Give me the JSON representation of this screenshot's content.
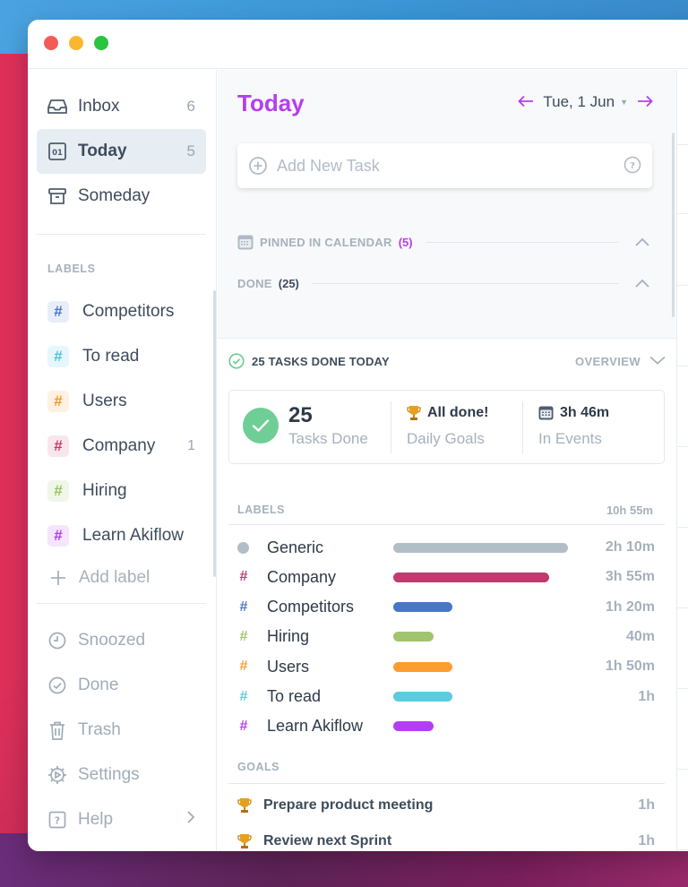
{
  "window": {
    "controls": [
      "close",
      "minimize",
      "maximize"
    ]
  },
  "sidebar": {
    "nav": [
      {
        "label": "Inbox",
        "count": "6",
        "icon": "inbox-icon"
      },
      {
        "label": "Today",
        "count": "5",
        "icon": "calendar-day-icon",
        "active": true
      },
      {
        "label": "Someday",
        "count": "",
        "icon": "archive-icon"
      }
    ],
    "labels_heading": "LABELS",
    "labels": [
      {
        "label": "Competitors",
        "count": "",
        "color": "#4a76c9",
        "bg": "#e8eef8"
      },
      {
        "label": "To read",
        "count": "",
        "color": "#4fc3dd",
        "bg": "#e6f7fb"
      },
      {
        "label": "Users",
        "count": "",
        "color": "#f59a2c",
        "bg": "#fef1e2"
      },
      {
        "label": "Company",
        "count": "1",
        "color": "#c93a6c",
        "bg": "#f9e6ed"
      },
      {
        "label": "Hiring",
        "count": "",
        "color": "#9ac266",
        "bg": "#f0f6e8"
      },
      {
        "label": "Learn Akiflow",
        "count": "",
        "color": "#b03ef3",
        "bg": "#f4e6fd"
      }
    ],
    "add_label": "Add label",
    "footer": [
      {
        "label": "Snoozed",
        "icon": "clock-icon"
      },
      {
        "label": "Done",
        "icon": "check-circle-icon"
      },
      {
        "label": "Trash",
        "icon": "trash-icon"
      },
      {
        "label": "Settings",
        "icon": "gear-icon"
      },
      {
        "label": "Help",
        "icon": "help-icon"
      }
    ]
  },
  "main": {
    "title": "Today",
    "date": "Tue, 1 Jun",
    "add_task_placeholder": "Add New Task",
    "pinned": {
      "label": "PINNED IN CALENDAR",
      "count": "(5)"
    },
    "done": {
      "label": "DONE",
      "count": "(25)"
    },
    "summary": {
      "heading": "25 TASKS DONE TODAY",
      "overview": "OVERVIEW",
      "tasks_done_value": "25",
      "tasks_done_label": "Tasks Done",
      "goals_value": "All done!",
      "goals_label": "Daily Goals",
      "events_value": "3h 46m",
      "events_label": "In Events"
    },
    "labels_heading": "LABELS",
    "labels_total": "10h 55m",
    "label_stats": [
      {
        "name": "Generic",
        "time": "2h 10m",
        "color": "#b2bec6",
        "marker": "dot",
        "fraction": 1.0
      },
      {
        "name": "Company",
        "time": "3h 55m",
        "color": "#c0396f",
        "marker": "#",
        "fraction": 0.89
      },
      {
        "name": "Competitors",
        "time": "1h 20m",
        "color": "#4a76c9",
        "marker": "#",
        "fraction": 0.34
      },
      {
        "name": "Hiring",
        "time": "40m",
        "color": "#a3c46f",
        "marker": "#",
        "fraction": 0.23
      },
      {
        "name": "Users",
        "time": "1h 50m",
        "color": "#fb9e2f",
        "marker": "#",
        "fraction": 0.34
      },
      {
        "name": "To read",
        "time": "1h",
        "color": "#5ccbdf",
        "marker": "#",
        "fraction": 0.34
      },
      {
        "name": "Learn Akiflow",
        "time": "",
        "color": "#b43ef5",
        "marker": "#",
        "fraction": 0.23
      }
    ],
    "goals_heading": "GOALS",
    "goals": [
      {
        "name": "Prepare product meeting",
        "time": "1h"
      },
      {
        "name": "Review next Sprint",
        "time": "1h"
      }
    ]
  },
  "colors": {
    "accent": "#b53ef0",
    "success": "#6fce95"
  }
}
